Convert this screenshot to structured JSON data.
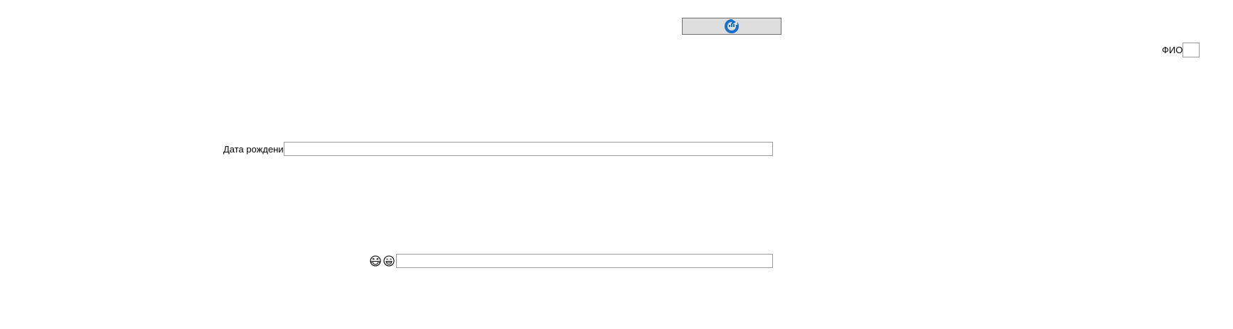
{
  "toolbar": {
    "refresh_icon": "refresh-icon",
    "accent_color": "#1a6fc9"
  },
  "form": {
    "fio": {
      "label": "ФИО",
      "value": ""
    },
    "birth_date": {
      "label": "Дата рождения",
      "value": ""
    },
    "emoji_field": {
      "icons": [
        "laughing-face-icon",
        "grinning-face-icon"
      ],
      "value": ""
    }
  }
}
